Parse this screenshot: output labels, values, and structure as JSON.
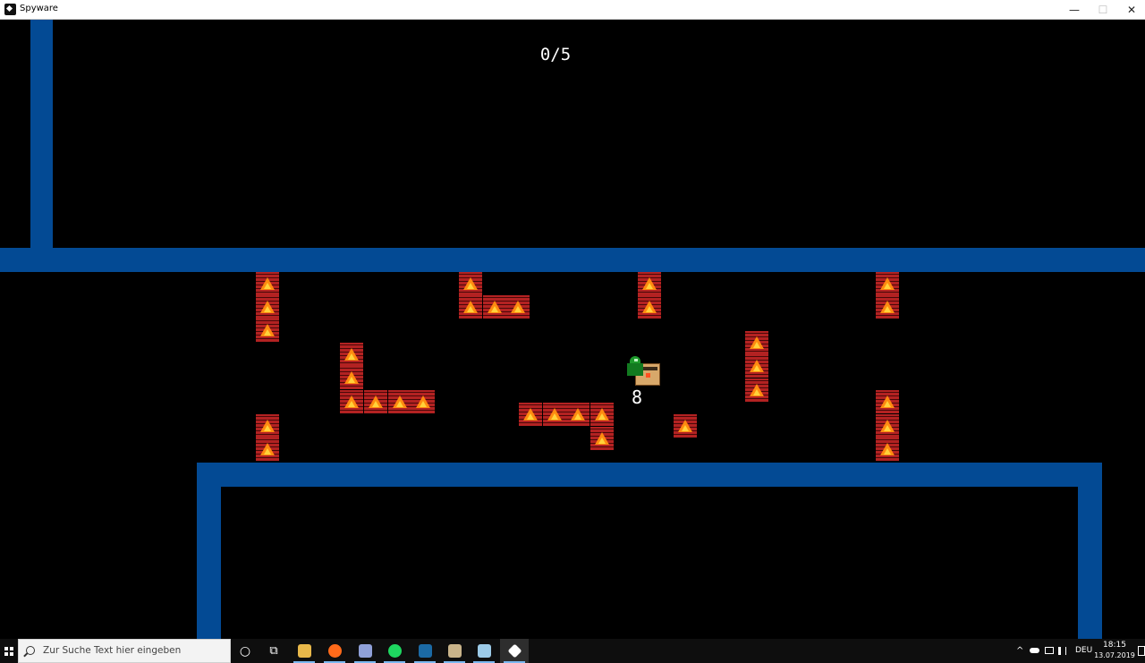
{
  "window": {
    "title": "Spyware",
    "controls": {
      "minimize": "—",
      "maximize": "☐",
      "close": "✕"
    }
  },
  "game": {
    "counter": "0/5",
    "timer": "8",
    "colors": {
      "background": "#000000",
      "wall": "#034a94",
      "hazard": "#b32222",
      "flame": "#ff8a10",
      "player": "#1e9a2c"
    },
    "player_icon": "green-spy-icon",
    "crate_icon": "crate-icon",
    "hazard_icon": "fire-brick-icon"
  },
  "taskbar": {
    "start_icon": "windows-logo-icon",
    "search_placeholder": "Zur Suche Text hier eingeben",
    "apps": [
      {
        "name": "cortana-icon",
        "symbol": "○"
      },
      {
        "name": "task-view-icon",
        "symbol": "⧉"
      },
      {
        "name": "file-explorer-icon",
        "color": "#e8b84a"
      },
      {
        "name": "firefox-icon",
        "color": "#ff6a1a"
      },
      {
        "name": "discord-icon",
        "color": "#8fa0d8"
      },
      {
        "name": "spotify-icon",
        "color": "#1ed760"
      },
      {
        "name": "steam-icon",
        "color": "#1b6aa5"
      },
      {
        "name": "app-icon",
        "color": "#c9b48a"
      },
      {
        "name": "notes-icon",
        "color": "#9ccbe8"
      },
      {
        "name": "spyware-game-icon",
        "color": "#ffffff"
      }
    ],
    "tray": {
      "chevron": "^",
      "language": "DEU"
    },
    "clock": {
      "time": "18:15",
      "date": "13.07.2019"
    }
  }
}
